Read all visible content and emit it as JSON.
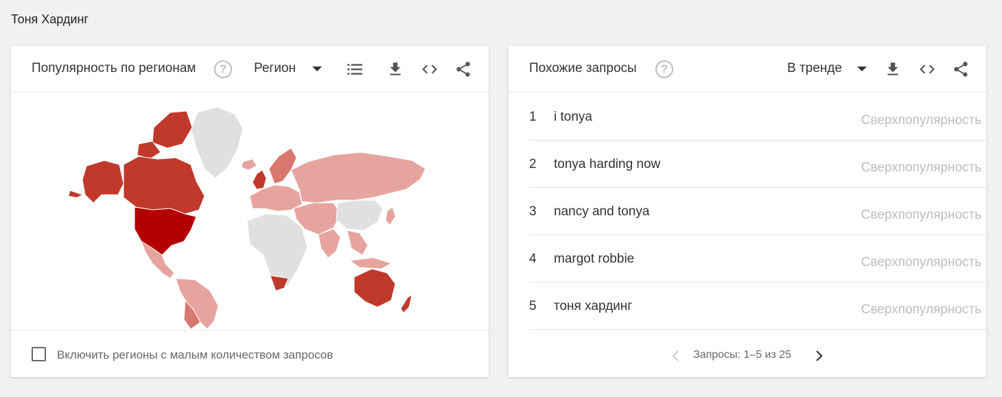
{
  "page": {
    "title": "Тоня Хардинг"
  },
  "regions_card": {
    "title": "Популярность по регионам",
    "help_icon": "?",
    "dropdown_label": "Регион",
    "footer_checkbox_label": "Включить регионы с малым количеством запросов",
    "colors": {
      "strongest": "#b50000",
      "strong": "#c0392b",
      "medium": "#d9786f",
      "light": "#e6a49e",
      "no_data": "#e0e0e0"
    }
  },
  "queries_card": {
    "title": "Похожие запросы",
    "help_icon": "?",
    "dropdown_label": "В тренде",
    "rows": [
      {
        "index": "1",
        "query": "i tonya",
        "status": "Сверхпопулярность"
      },
      {
        "index": "2",
        "query": "tonya harding now",
        "status": "Сверхпопулярность"
      },
      {
        "index": "3",
        "query": "nancy and tonya",
        "status": "Сверхпопулярность"
      },
      {
        "index": "4",
        "query": "margot robbie",
        "status": "Сверхпопулярность"
      },
      {
        "index": "5",
        "query": "тоня хардинг",
        "status": "Сверхпопулярность"
      }
    ],
    "pager_text": "Запросы: 1–5 из 25"
  }
}
